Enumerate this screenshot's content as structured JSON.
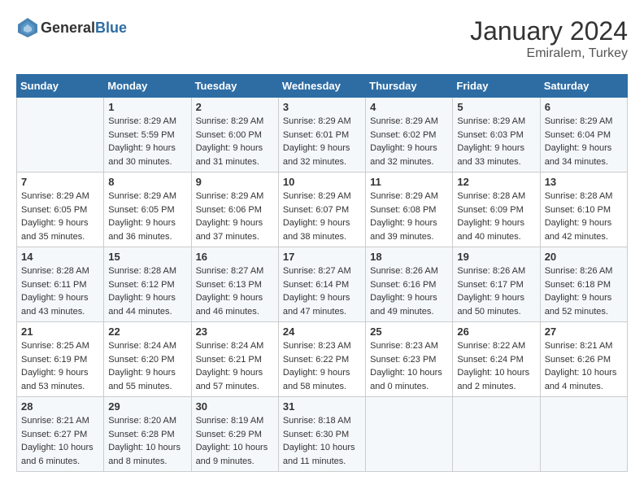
{
  "header": {
    "logo": {
      "general": "General",
      "blue": "Blue"
    },
    "title": "January 2024",
    "location": "Emiralem, Turkey"
  },
  "columns": [
    "Sunday",
    "Monday",
    "Tuesday",
    "Wednesday",
    "Thursday",
    "Friday",
    "Saturday"
  ],
  "weeks": [
    [
      {
        "day": "",
        "sunrise": "",
        "sunset": "",
        "daylight": ""
      },
      {
        "day": "1",
        "sunrise": "Sunrise: 8:29 AM",
        "sunset": "Sunset: 5:59 PM",
        "daylight": "Daylight: 9 hours and 30 minutes."
      },
      {
        "day": "2",
        "sunrise": "Sunrise: 8:29 AM",
        "sunset": "Sunset: 6:00 PM",
        "daylight": "Daylight: 9 hours and 31 minutes."
      },
      {
        "day": "3",
        "sunrise": "Sunrise: 8:29 AM",
        "sunset": "Sunset: 6:01 PM",
        "daylight": "Daylight: 9 hours and 32 minutes."
      },
      {
        "day": "4",
        "sunrise": "Sunrise: 8:29 AM",
        "sunset": "Sunset: 6:02 PM",
        "daylight": "Daylight: 9 hours and 32 minutes."
      },
      {
        "day": "5",
        "sunrise": "Sunrise: 8:29 AM",
        "sunset": "Sunset: 6:03 PM",
        "daylight": "Daylight: 9 hours and 33 minutes."
      },
      {
        "day": "6",
        "sunrise": "Sunrise: 8:29 AM",
        "sunset": "Sunset: 6:04 PM",
        "daylight": "Daylight: 9 hours and 34 minutes."
      }
    ],
    [
      {
        "day": "7",
        "sunrise": "Sunrise: 8:29 AM",
        "sunset": "Sunset: 6:05 PM",
        "daylight": "Daylight: 9 hours and 35 minutes."
      },
      {
        "day": "8",
        "sunrise": "Sunrise: 8:29 AM",
        "sunset": "Sunset: 6:05 PM",
        "daylight": "Daylight: 9 hours and 36 minutes."
      },
      {
        "day": "9",
        "sunrise": "Sunrise: 8:29 AM",
        "sunset": "Sunset: 6:06 PM",
        "daylight": "Daylight: 9 hours and 37 minutes."
      },
      {
        "day": "10",
        "sunrise": "Sunrise: 8:29 AM",
        "sunset": "Sunset: 6:07 PM",
        "daylight": "Daylight: 9 hours and 38 minutes."
      },
      {
        "day": "11",
        "sunrise": "Sunrise: 8:29 AM",
        "sunset": "Sunset: 6:08 PM",
        "daylight": "Daylight: 9 hours and 39 minutes."
      },
      {
        "day": "12",
        "sunrise": "Sunrise: 8:28 AM",
        "sunset": "Sunset: 6:09 PM",
        "daylight": "Daylight: 9 hours and 40 minutes."
      },
      {
        "day": "13",
        "sunrise": "Sunrise: 8:28 AM",
        "sunset": "Sunset: 6:10 PM",
        "daylight": "Daylight: 9 hours and 42 minutes."
      }
    ],
    [
      {
        "day": "14",
        "sunrise": "Sunrise: 8:28 AM",
        "sunset": "Sunset: 6:11 PM",
        "daylight": "Daylight: 9 hours and 43 minutes."
      },
      {
        "day": "15",
        "sunrise": "Sunrise: 8:28 AM",
        "sunset": "Sunset: 6:12 PM",
        "daylight": "Daylight: 9 hours and 44 minutes."
      },
      {
        "day": "16",
        "sunrise": "Sunrise: 8:27 AM",
        "sunset": "Sunset: 6:13 PM",
        "daylight": "Daylight: 9 hours and 46 minutes."
      },
      {
        "day": "17",
        "sunrise": "Sunrise: 8:27 AM",
        "sunset": "Sunset: 6:14 PM",
        "daylight": "Daylight: 9 hours and 47 minutes."
      },
      {
        "day": "18",
        "sunrise": "Sunrise: 8:26 AM",
        "sunset": "Sunset: 6:16 PM",
        "daylight": "Daylight: 9 hours and 49 minutes."
      },
      {
        "day": "19",
        "sunrise": "Sunrise: 8:26 AM",
        "sunset": "Sunset: 6:17 PM",
        "daylight": "Daylight: 9 hours and 50 minutes."
      },
      {
        "day": "20",
        "sunrise": "Sunrise: 8:26 AM",
        "sunset": "Sunset: 6:18 PM",
        "daylight": "Daylight: 9 hours and 52 minutes."
      }
    ],
    [
      {
        "day": "21",
        "sunrise": "Sunrise: 8:25 AM",
        "sunset": "Sunset: 6:19 PM",
        "daylight": "Daylight: 9 hours and 53 minutes."
      },
      {
        "day": "22",
        "sunrise": "Sunrise: 8:24 AM",
        "sunset": "Sunset: 6:20 PM",
        "daylight": "Daylight: 9 hours and 55 minutes."
      },
      {
        "day": "23",
        "sunrise": "Sunrise: 8:24 AM",
        "sunset": "Sunset: 6:21 PM",
        "daylight": "Daylight: 9 hours and 57 minutes."
      },
      {
        "day": "24",
        "sunrise": "Sunrise: 8:23 AM",
        "sunset": "Sunset: 6:22 PM",
        "daylight": "Daylight: 9 hours and 58 minutes."
      },
      {
        "day": "25",
        "sunrise": "Sunrise: 8:23 AM",
        "sunset": "Sunset: 6:23 PM",
        "daylight": "Daylight: 10 hours and 0 minutes."
      },
      {
        "day": "26",
        "sunrise": "Sunrise: 8:22 AM",
        "sunset": "Sunset: 6:24 PM",
        "daylight": "Daylight: 10 hours and 2 minutes."
      },
      {
        "day": "27",
        "sunrise": "Sunrise: 8:21 AM",
        "sunset": "Sunset: 6:26 PM",
        "daylight": "Daylight: 10 hours and 4 minutes."
      }
    ],
    [
      {
        "day": "28",
        "sunrise": "Sunrise: 8:21 AM",
        "sunset": "Sunset: 6:27 PM",
        "daylight": "Daylight: 10 hours and 6 minutes."
      },
      {
        "day": "29",
        "sunrise": "Sunrise: 8:20 AM",
        "sunset": "Sunset: 6:28 PM",
        "daylight": "Daylight: 10 hours and 8 minutes."
      },
      {
        "day": "30",
        "sunrise": "Sunrise: 8:19 AM",
        "sunset": "Sunset: 6:29 PM",
        "daylight": "Daylight: 10 hours and 9 minutes."
      },
      {
        "day": "31",
        "sunrise": "Sunrise: 8:18 AM",
        "sunset": "Sunset: 6:30 PM",
        "daylight": "Daylight: 10 hours and 11 minutes."
      },
      {
        "day": "",
        "sunrise": "",
        "sunset": "",
        "daylight": ""
      },
      {
        "day": "",
        "sunrise": "",
        "sunset": "",
        "daylight": ""
      },
      {
        "day": "",
        "sunrise": "",
        "sunset": "",
        "daylight": ""
      }
    ]
  ]
}
